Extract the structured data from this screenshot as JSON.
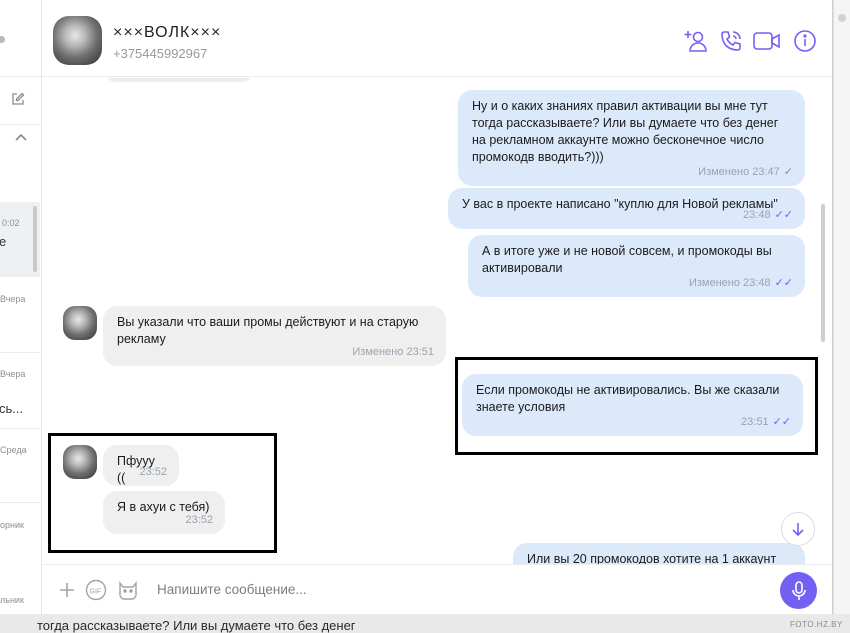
{
  "colors": {
    "accent": "#7360f2",
    "bubble_out": "#dbe9fb",
    "bubble_in": "#efefef"
  },
  "sidebar": {
    "items": [
      {
        "time": "0:02",
        "preview": "е"
      },
      {
        "time": "Вчера",
        "preview": ""
      },
      {
        "time": "Вчера",
        "preview": "сь..."
      },
      {
        "time": "Среда",
        "preview": ""
      },
      {
        "time": "орник",
        "preview": ""
      },
      {
        "time": "льник",
        "preview": ""
      }
    ]
  },
  "header": {
    "contact_name": "×××ВОЛК×××",
    "contact_phone": "+375445992967",
    "icons": [
      "add-participant-icon",
      "call-icon",
      "video-call-icon",
      "info-icon"
    ]
  },
  "messages": [
    {
      "direction": "out",
      "text": "Ну и о каких знаниях  правил активации вы мне тут тогда рассказываете? Или вы думаете что без денег на рекламном аккаунте можно бесконечное число промокодв вводить?)))",
      "meta": "Изменено 23:47",
      "status": "sent"
    },
    {
      "direction": "out",
      "text": "У вас в проекте написано \"куплю для Новой рекламы\"",
      "meta": "23:48",
      "status": "read"
    },
    {
      "direction": "out",
      "text": "А в итоге уже и не новой совсем, и промокоды вы активировали",
      "meta": "Изменено 23:48",
      "status": "read"
    },
    {
      "direction": "in",
      "text": "Вы указали что ваши промы действуют и на старую рекламу",
      "meta": "Изменено 23:51"
    },
    {
      "direction": "out",
      "text": "Если промокоды не активировались. Вы же сказали знаете условия",
      "meta": "23:51",
      "status": "read"
    },
    {
      "direction": "in",
      "text": "Пфууу ((",
      "meta": "23:52"
    },
    {
      "direction": "in",
      "text": "Я в ахуи с тебя)",
      "meta": "23:52"
    },
    {
      "direction": "out",
      "text": "Или вы 20 промокодов хотите на 1 аккаунт",
      "meta": "",
      "status": ""
    }
  ],
  "composer": {
    "placeholder": "Напишите сообщение...",
    "icons": [
      "plus-icon",
      "gif-icon",
      "sticker-icon",
      "microphone-icon"
    ]
  },
  "background": {
    "bottom_text": "тогда рассказываете? Или вы думаете что без денег",
    "watermark": "FOTO.HZ.BY"
  }
}
